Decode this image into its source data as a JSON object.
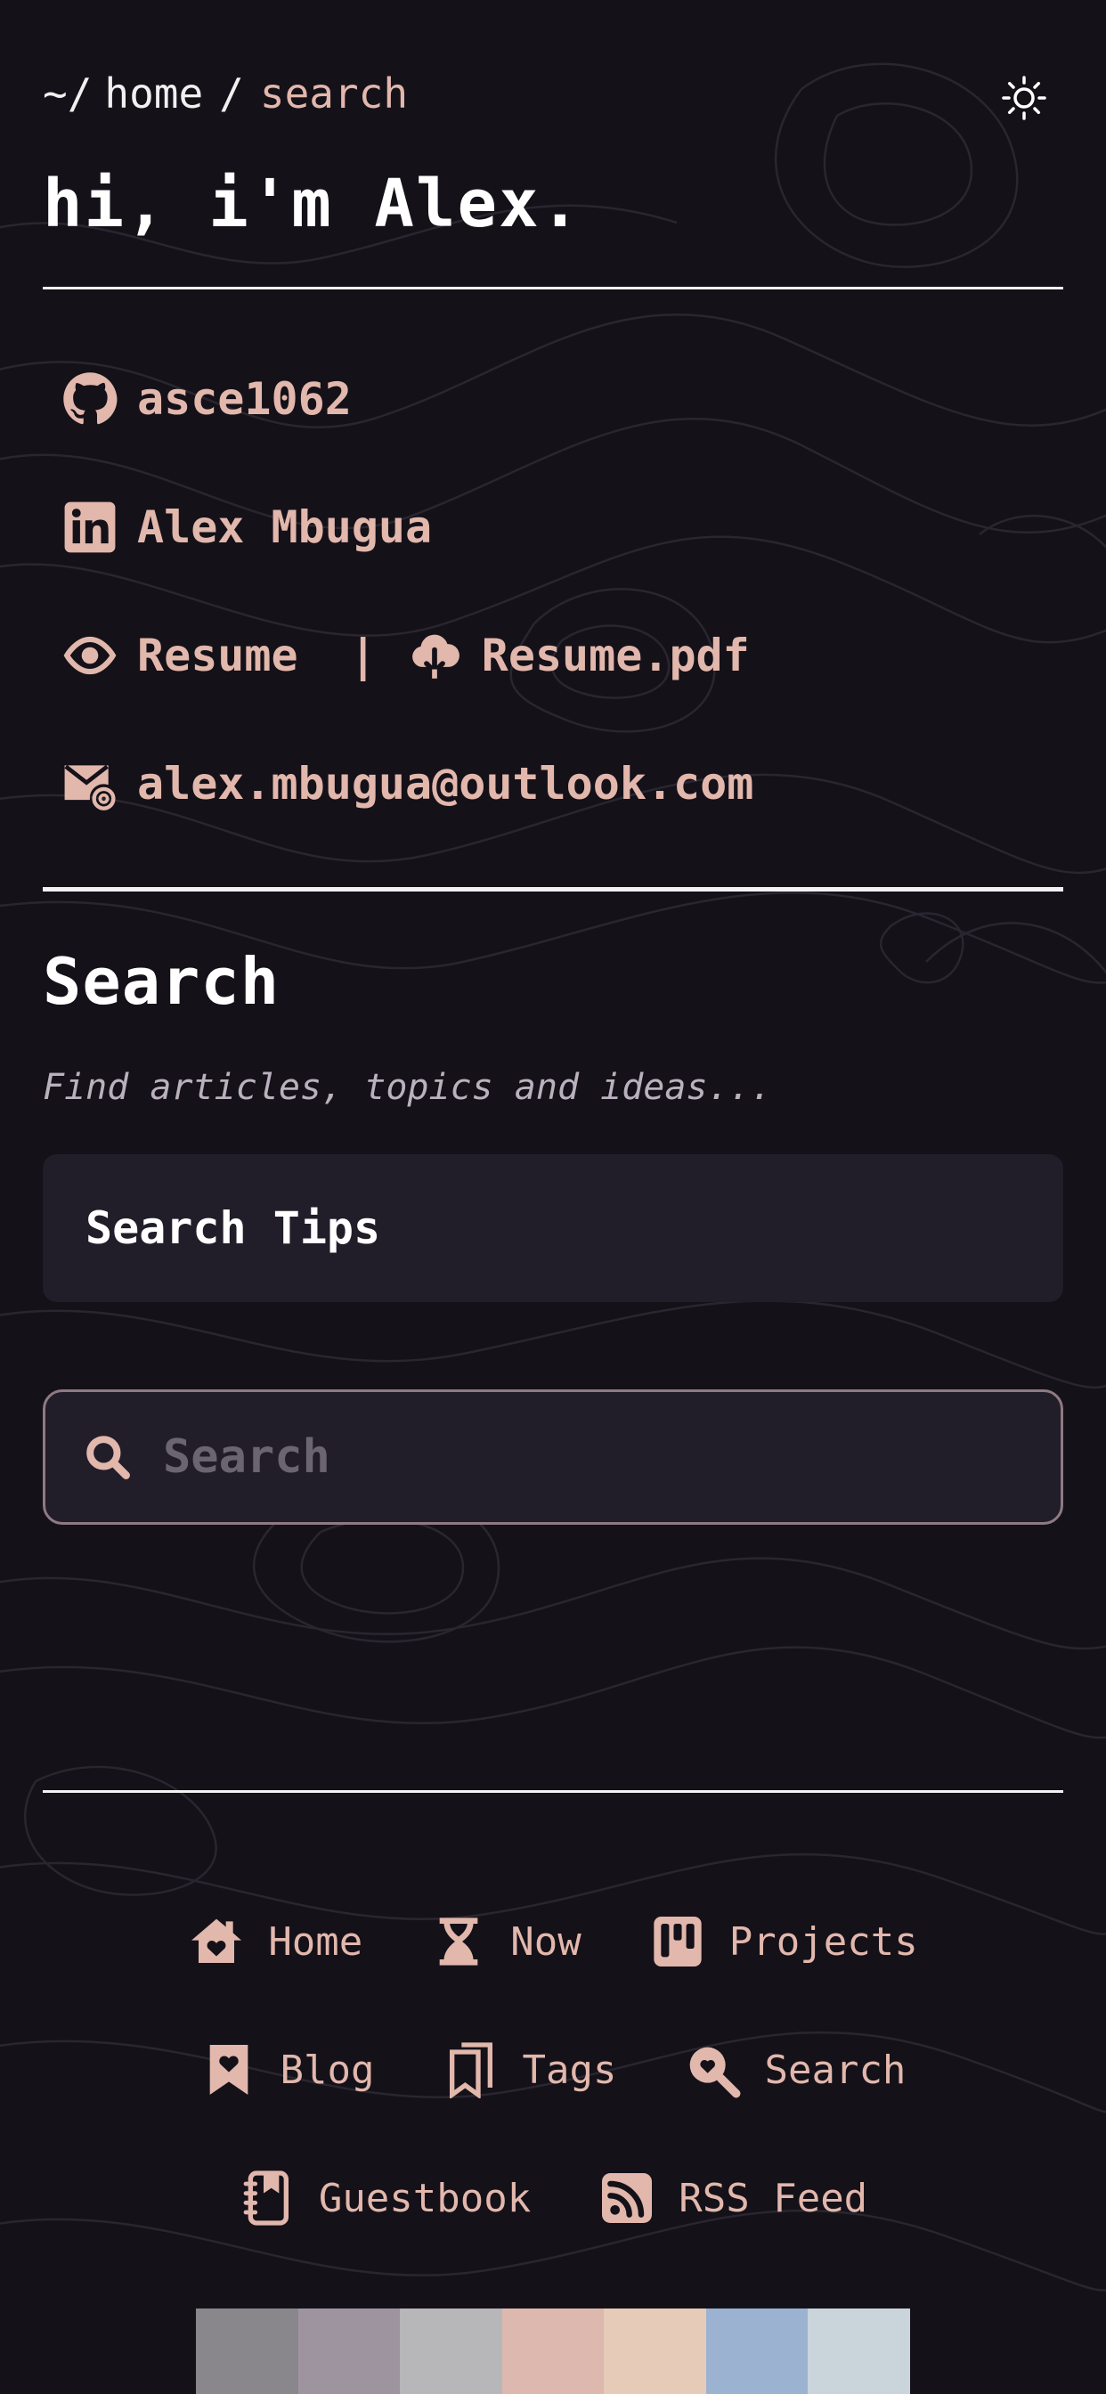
{
  "header": {
    "breadcrumb_root": "~/",
    "breadcrumb_home": "home",
    "breadcrumb_sep": "/",
    "breadcrumb_current": "search",
    "theme_icon": "sun-icon",
    "greeting": "hi, i'm Alex."
  },
  "contacts": {
    "github": {
      "icon": "github-icon",
      "label": "asce1062"
    },
    "linkedin": {
      "icon": "linkedin-icon",
      "label": "Alex Mbugua"
    },
    "resume": {
      "icon": "eye-icon",
      "label": "Resume"
    },
    "divider": "|",
    "resume_pdf": {
      "icon": "cloud-download-icon",
      "label": "Resume.pdf"
    },
    "email": {
      "icon": "mail-at-icon",
      "label": "alex.mbugua@outlook.com"
    }
  },
  "search": {
    "title": "Search",
    "subtitle": "Find articles, topics and ideas...",
    "tips_label": "Search Tips",
    "placeholder": "Search",
    "value": ""
  },
  "footer_nav": {
    "rows": [
      [
        {
          "icon": "home-heart-icon",
          "label": "Home"
        },
        {
          "icon": "hourglass-icon",
          "label": "Now"
        },
        {
          "icon": "kanban-icon",
          "label": "Projects"
        }
      ],
      [
        {
          "icon": "bookmark-heart-icon",
          "label": "Blog"
        },
        {
          "icon": "bookmarks-icon",
          "label": "Tags"
        },
        {
          "icon": "search-heart-icon",
          "label": "Search"
        }
      ],
      [
        {
          "icon": "guestbook-icon",
          "label": "Guestbook"
        },
        {
          "icon": "rss-icon",
          "label": "RSS Feed"
        }
      ]
    ]
  },
  "palette": [
    "#8a878c",
    "#9e94a0",
    "#b7b6b8",
    "#dcb8ae",
    "#e6cbb8",
    "#9cb2d1",
    "#c9d4db"
  ],
  "colors": {
    "background": "#141119",
    "accent": "#e2b7ac",
    "panel": "#211e2a",
    "text": "#ffffff"
  }
}
